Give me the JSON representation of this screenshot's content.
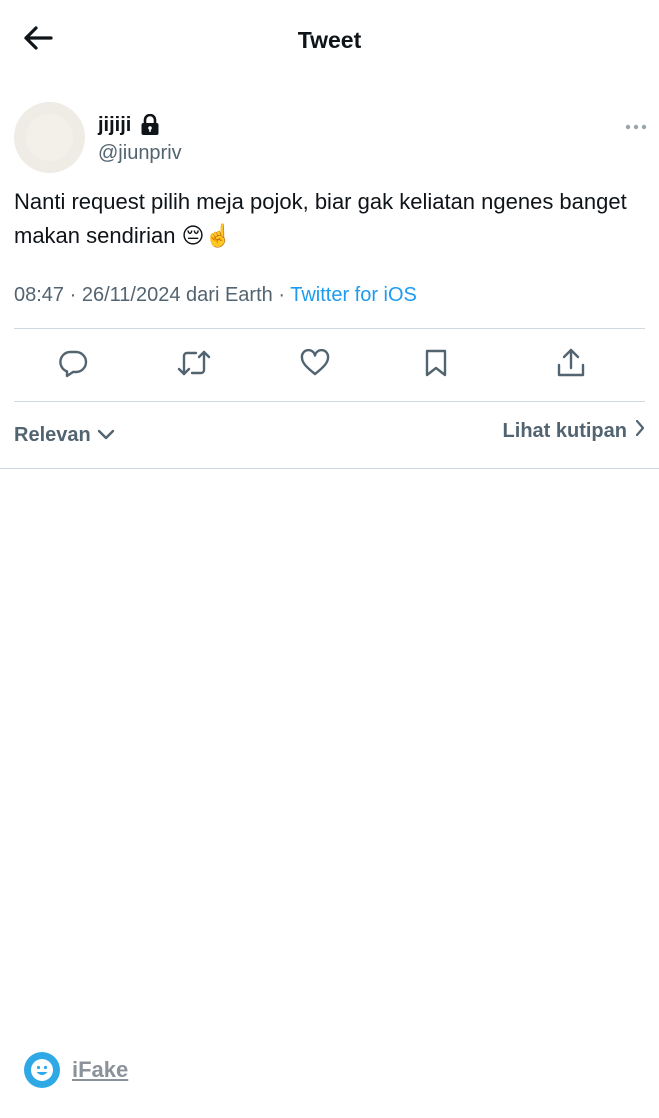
{
  "header": {
    "title": "Tweet",
    "back_icon": "arrow-left-icon"
  },
  "author": {
    "display_name": "jijiji",
    "handle": "@jiunpriv",
    "protected_icon": "lock-icon"
  },
  "tweet": {
    "text": "Nanti request pilih meja pojok, biar gak keliatan ngenes banget makan sendirian 😔☝️",
    "time": "08:47",
    "date": "26/11/2024",
    "location": "dari Earth",
    "source": "Twitter for iOS",
    "separator": "·"
  },
  "actions": [
    {
      "name": "reply",
      "icon": "reply-icon"
    },
    {
      "name": "retweet",
      "icon": "retweet-icon"
    },
    {
      "name": "like",
      "icon": "heart-icon"
    },
    {
      "name": "bookmark",
      "icon": "bookmark-icon"
    },
    {
      "name": "share",
      "icon": "share-icon"
    }
  ],
  "replies_bar": {
    "sort_label": "Relevan",
    "quotes_label": "Lihat kutipan"
  },
  "watermark": {
    "label": "iFake"
  },
  "colors": {
    "link": "#1d9bf0",
    "secondary_text": "#536471",
    "divider": "#cfd9de",
    "watermark_logo": "#2fa9e6"
  }
}
